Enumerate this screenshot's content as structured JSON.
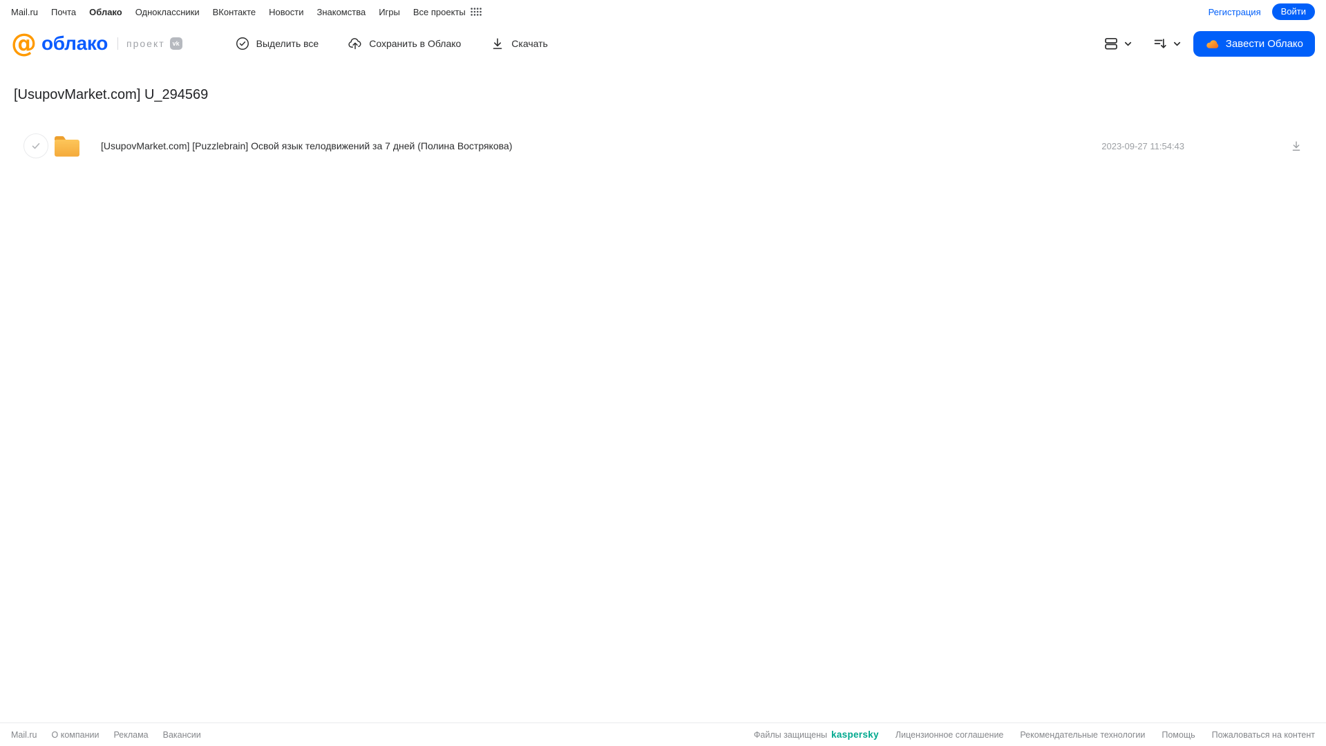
{
  "topnav": {
    "links": [
      "Mail.ru",
      "Почта",
      "Облако",
      "Одноклассники",
      "ВКонтакте",
      "Новости",
      "Знакомства",
      "Игры",
      "Все проекты"
    ],
    "registration_label": "Регистрация",
    "login_label": "Войти"
  },
  "header": {
    "logo_at": "@",
    "logo_text": "облако",
    "project_label": "проект",
    "vk_badge_label": "vk",
    "toolbar": {
      "select_all": "Выделить все",
      "save_to_cloud": "Сохранить в Облако",
      "download": "Скачать"
    },
    "cta_label": "Завести Облако"
  },
  "main": {
    "title": "[UsupovMarket.com] U_294569",
    "files": [
      {
        "name": "[UsupovMarket.com] [Puzzlebrain] Освой язык телодвижений за 7 дней (Полина Вострякова)",
        "date": "2023-09-27 11:54:43",
        "type": "folder"
      }
    ]
  },
  "footer": {
    "links_left": [
      "Mail.ru",
      "О компании",
      "Реклама",
      "Вакансии"
    ],
    "protected_label": "Файлы защищены",
    "kaspersky_label": "kaspersky",
    "links_right": [
      "Лицензионное соглашение",
      "Рекомендательные технологии",
      "Помощь",
      "Пожаловаться на контент"
    ]
  },
  "icons": {
    "apps_grid": "apps-grid-icon",
    "select_all": "circle-check-icon",
    "save_to_cloud": "cloud-upload-icon",
    "download": "download-icon",
    "view": "rows-view-icon",
    "sort": "sort-icon",
    "chevron": "chevron-down-icon",
    "cta_cloud": "cloud-icon",
    "file": "folder-icon"
  },
  "colors": {
    "accent_blue": "#005ff9",
    "logo_blue": "#0b5cff",
    "logo_orange": "#ff9a00",
    "folder_yellow": "#f8ba4b",
    "folder_tab": "#eda02f",
    "kaspersky_green": "#00a88e",
    "text_dark": "#2c2d2e",
    "text_gray": "#9da0a4",
    "footer_gray": "#85878b"
  }
}
